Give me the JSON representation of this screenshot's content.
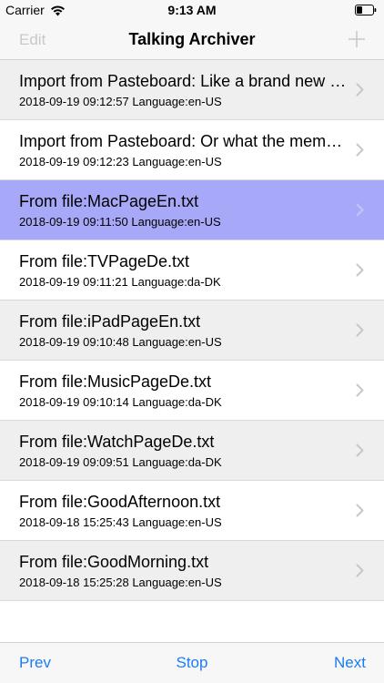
{
  "status_bar": {
    "carrier": "Carrier",
    "time": "9:13 AM"
  },
  "nav": {
    "edit_label": "Edit",
    "title": "Talking Archiver",
    "add_icon": "plus-icon"
  },
  "items": [
    {
      "title": "Import from Pasteboard: Like a brand new n...",
      "subtitle": "2018-09-19 09:12:57 Language:en-US",
      "style": "shaded"
    },
    {
      "title": "Import from Pasteboard: Or what the memor...",
      "subtitle": "2018-09-19 09:12:23 Language:en-US",
      "style": "white"
    },
    {
      "title": "From file:MacPageEn.txt",
      "subtitle": "2018-09-19 09:11:50 Language:en-US",
      "style": "selected"
    },
    {
      "title": "From file:TVPageDe.txt",
      "subtitle": "2018-09-19 09:11:21 Language:da-DK",
      "style": "white"
    },
    {
      "title": "From file:iPadPageEn.txt",
      "subtitle": "2018-09-19 09:10:48 Language:en-US",
      "style": "shaded"
    },
    {
      "title": "From file:MusicPageDe.txt",
      "subtitle": "2018-09-19 09:10:14 Language:da-DK",
      "style": "white"
    },
    {
      "title": "From file:WatchPageDe.txt",
      "subtitle": "2018-09-19 09:09:51 Language:da-DK",
      "style": "shaded"
    },
    {
      "title": "From file:GoodAfternoon.txt",
      "subtitle": "2018-09-18 15:25:43 Language:en-US",
      "style": "white"
    },
    {
      "title": "From file:GoodMorning.txt",
      "subtitle": "2018-09-18 15:25:28 Language:en-US",
      "style": "shaded"
    }
  ],
  "toolbar": {
    "prev_label": "Prev",
    "stop_label": "Stop",
    "next_label": "Next"
  },
  "colors": {
    "accent": "#1a7cf4",
    "selected_row": "#a8a8f8",
    "shaded_row": "#efeff0",
    "disabled": "#c8c8cc"
  }
}
